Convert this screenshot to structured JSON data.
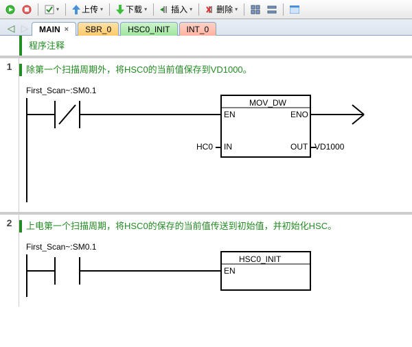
{
  "toolbar": {
    "upload": "上传",
    "download": "下载",
    "insert": "插入",
    "delete": "删除"
  },
  "tabs": {
    "main": "MAIN",
    "sbr0": "SBR_0",
    "hsc0_init": "HSC0_INIT",
    "int0": "INT_0"
  },
  "program_comment_title": "程序注释",
  "networks": [
    {
      "number": "1",
      "comment": "除第一个扫描周期外，将HSC0的当前值保存到VD1000。",
      "contact_label": "First_Scan~:SM0.1",
      "block": {
        "title": "MOV_DW",
        "en": "EN",
        "eno": "ENO",
        "in": "IN",
        "out": "OUT",
        "in_val": "HC0",
        "out_val": "VD1000"
      }
    },
    {
      "number": "2",
      "comment": "上电第一个扫描周期，将HSC0的保存的当前值传送到初始值，并初始化HSC。",
      "contact_label": "First_Scan~:SM0.1",
      "block": {
        "title": "HSC0_INIT",
        "en": "EN"
      }
    }
  ]
}
